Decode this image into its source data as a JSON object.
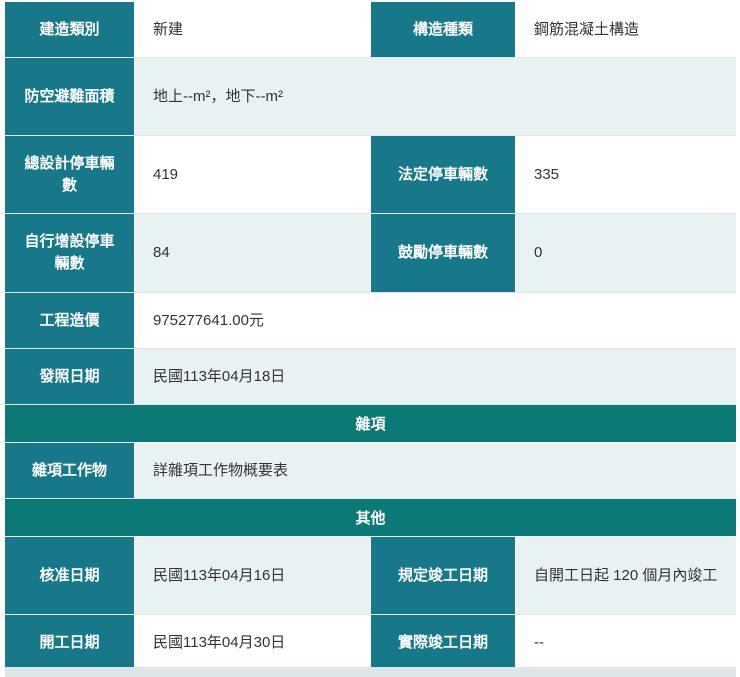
{
  "rows": [
    {
      "l1": "建造類別",
      "v1": "新建",
      "l2": "構造種類",
      "v2": "鋼筋混凝土構造"
    },
    {
      "l1": "防空避難面積",
      "v1": "地上--m²，地下--m²"
    },
    {
      "l1": "總設計停車輛數",
      "v1": "419",
      "l2": "法定停車輛數",
      "v2": "335"
    },
    {
      "l1": "自行增設停車輛數",
      "v1": "84",
      "l2": "鼓勵停車輛數",
      "v2": "0"
    },
    {
      "l1": "工程造價",
      "v1": "975277641.00元"
    },
    {
      "l1": "發照日期",
      "v1": "民國113年04月18日"
    }
  ],
  "section_misc": "雜項",
  "misc": {
    "l1": "雜項工作物",
    "v1": "詳雜項工作物概要表"
  },
  "section_other": "其他",
  "other": [
    {
      "l1": "核准日期",
      "v1": "民國113年04月16日",
      "l2": "規定竣工日期",
      "v2": "自開工日起 120 個月內竣工"
    },
    {
      "l1": "開工日期",
      "v1": "民國113年04月30日",
      "l2": "實際竣工日期",
      "v2": "--"
    }
  ]
}
